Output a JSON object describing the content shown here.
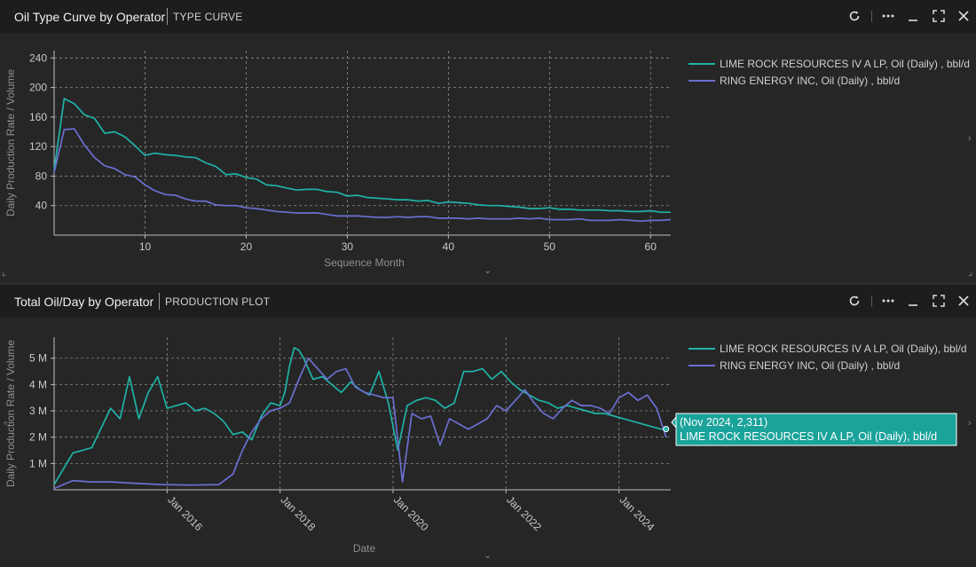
{
  "panels": [
    {
      "title": "Oil Type Curve by Operator",
      "subtitle": "TYPE CURVE",
      "icons": [
        "refresh-icon",
        "more-icon",
        "minimize-icon",
        "fullscreen-icon",
        "close-icon"
      ]
    },
    {
      "title": "Total Oil/Day by Operator",
      "subtitle": "PRODUCTION PLOT",
      "icons": [
        "refresh-icon",
        "more-icon",
        "minimize-icon",
        "fullscreen-icon",
        "close-icon"
      ]
    }
  ],
  "colors": {
    "teal": "#1fb3a6",
    "blue": "#6b6fd1",
    "grid": "#8c8c8c"
  },
  "chart_data": [
    {
      "type": "line",
      "title": "Oil Type Curve by Operator",
      "xlabel": "Sequence Month",
      "ylabel": "Daily Production Rate / Volume",
      "xlim": [
        1,
        62
      ],
      "ylim": [
        0,
        250
      ],
      "x_ticks": [
        10,
        20,
        30,
        40,
        50,
        60
      ],
      "y_ticks": [
        40,
        80,
        120,
        160,
        200,
        240
      ],
      "y_tick_labels": [
        "40",
        "80",
        "120",
        "160",
        "200",
        "240"
      ],
      "grid": true,
      "legend_position": "right",
      "series": [
        {
          "name": "LIME ROCK RESOURCES IV A LP, Oil (Daily) , bbl/d",
          "color": "#1fb3a6",
          "x": [
            1,
            2,
            3,
            4,
            5,
            6,
            7,
            8,
            9,
            10,
            11,
            12,
            13,
            14,
            15,
            16,
            17,
            18,
            19,
            20,
            21,
            22,
            23,
            24,
            25,
            26,
            27,
            28,
            29,
            30,
            31,
            32,
            33,
            34,
            35,
            36,
            37,
            38,
            39,
            40,
            41,
            42,
            43,
            44,
            45,
            46,
            47,
            48,
            49,
            50,
            51,
            52,
            53,
            54,
            55,
            56,
            57,
            58,
            59,
            60,
            61,
            62
          ],
          "y": [
            88,
            185,
            178,
            163,
            158,
            138,
            140,
            133,
            121,
            108,
            111,
            109,
            108,
            106,
            105,
            98,
            93,
            82,
            83,
            78,
            76,
            68,
            67,
            64,
            61,
            62,
            62,
            59,
            58,
            53,
            54,
            51,
            50,
            49,
            48,
            48,
            46,
            47,
            43,
            45,
            44,
            43,
            41,
            40,
            40,
            39,
            38,
            36,
            36,
            37,
            35,
            35,
            34,
            34,
            34,
            33,
            33,
            32,
            32,
            33,
            31,
            31
          ]
        },
        {
          "name": "RING ENERGY INC, Oil (Daily) , bbl/d",
          "color": "#6b6fd1",
          "x": [
            1,
            2,
            3,
            4,
            5,
            6,
            7,
            8,
            9,
            10,
            11,
            12,
            13,
            14,
            15,
            16,
            17,
            18,
            19,
            20,
            21,
            22,
            23,
            24,
            25,
            26,
            27,
            28,
            29,
            30,
            31,
            32,
            33,
            34,
            35,
            36,
            37,
            38,
            39,
            40,
            41,
            42,
            43,
            44,
            45,
            46,
            47,
            48,
            49,
            50,
            51,
            52,
            53,
            54,
            55,
            56,
            57,
            58,
            59,
            60,
            61,
            62
          ],
          "y": [
            85,
            143,
            144,
            122,
            105,
            94,
            90,
            82,
            79,
            68,
            60,
            55,
            54,
            49,
            46,
            46,
            41,
            40,
            40,
            37,
            36,
            34,
            32,
            31,
            30,
            30,
            30,
            28,
            26,
            26,
            26,
            25,
            24,
            24,
            25,
            24,
            25,
            25,
            23,
            23,
            23,
            22,
            23,
            22,
            22,
            22,
            23,
            22,
            23,
            21,
            21,
            21,
            22,
            20,
            20,
            20,
            21,
            20,
            19,
            20,
            20,
            21
          ]
        }
      ]
    },
    {
      "type": "line",
      "title": "Total Oil/Day by Operator",
      "xlabel": "Date",
      "ylabel": "Daily Production Rate / Volume",
      "xlim": [
        "Jan 2014",
        "Dec 2024"
      ],
      "ylim": [
        0,
        5800000
      ],
      "x_ticks": [
        "Jan 2016",
        "Jan 2018",
        "Jan 2020",
        "Jan 2022",
        "Jan 2024"
      ],
      "y_ticks": [
        1000000,
        2000000,
        3000000,
        4000000,
        5000000
      ],
      "y_tick_labels": [
        "1 M",
        "2 M",
        "3 M",
        "4 M",
        "5 M"
      ],
      "grid": true,
      "legend_position": "right",
      "series": [
        {
          "name": "LIME ROCK RESOURCES IV A LP, Oil (Daily), bbl/d",
          "color": "#1fb3a6",
          "x": [
            "2014-01",
            "2014-05",
            "2014-09",
            "2015-01",
            "2015-03",
            "2015-05",
            "2015-07",
            "2015-09",
            "2015-11",
            "2016-01",
            "2016-03",
            "2016-05",
            "2016-07",
            "2016-09",
            "2016-11",
            "2017-01",
            "2017-03",
            "2017-05",
            "2017-07",
            "2017-09",
            "2017-11",
            "2018-01",
            "2018-02",
            "2018-03",
            "2018-04",
            "2018-05",
            "2018-06",
            "2018-08",
            "2018-10",
            "2018-12",
            "2019-02",
            "2019-04",
            "2019-06",
            "2019-08",
            "2019-10",
            "2019-12",
            "2020-02",
            "2020-04",
            "2020-06",
            "2020-08",
            "2020-10",
            "2020-12",
            "2021-02",
            "2021-04",
            "2021-06",
            "2021-08",
            "2021-10",
            "2021-12",
            "2022-02",
            "2022-04",
            "2022-06",
            "2022-08",
            "2022-10",
            "2022-12",
            "2023-02",
            "2023-04",
            "2023-06",
            "2023-08",
            "2023-10",
            "2023-12",
            "2024-02",
            "2024-04",
            "2024-06",
            "2024-08",
            "2024-10",
            "2024-11"
          ],
          "y": [
            200000,
            1400000,
            1600000,
            3100000,
            2700000,
            4300000,
            2700000,
            3700000,
            4300000,
            3100000,
            3200000,
            3300000,
            3000000,
            3100000,
            2900000,
            2600000,
            2100000,
            2200000,
            1900000,
            2800000,
            3300000,
            3200000,
            3700000,
            4700000,
            5400000,
            5300000,
            5000000,
            4200000,
            4300000,
            4000000,
            3700000,
            4100000,
            3800000,
            3600000,
            4500000,
            3300000,
            1500000,
            3200000,
            3400000,
            3500000,
            3400000,
            3100000,
            3300000,
            4500000,
            4500000,
            4600000,
            4200000,
            4500000,
            4100000,
            3800000,
            3600000,
            3400000,
            3300000,
            3100000,
            3200000,
            3100000,
            3000000,
            2900000,
            2900000,
            2800000,
            2700000,
            2600000,
            2500000,
            2400000,
            2300000,
            2311000
          ]
        },
        {
          "name": "RING ENERGY INC, Oil (Daily) , bbl/d",
          "color": "#6b6fd1",
          "x": [
            "2014-01",
            "2014-05",
            "2014-09",
            "2015-01",
            "2015-06",
            "2015-12",
            "2016-06",
            "2016-12",
            "2017-03",
            "2017-05",
            "2017-07",
            "2017-09",
            "2017-11",
            "2018-01",
            "2018-03",
            "2018-05",
            "2018-07",
            "2018-09",
            "2018-11",
            "2019-01",
            "2019-03",
            "2019-05",
            "2019-07",
            "2019-09",
            "2019-11",
            "2020-01",
            "2020-03",
            "2020-05",
            "2020-07",
            "2020-09",
            "2020-11",
            "2021-01",
            "2021-03",
            "2021-05",
            "2021-07",
            "2021-09",
            "2021-11",
            "2022-01",
            "2022-03",
            "2022-05",
            "2022-07",
            "2022-09",
            "2022-11",
            "2023-01",
            "2023-03",
            "2023-05",
            "2023-07",
            "2023-09",
            "2023-11",
            "2024-01",
            "2024-03",
            "2024-05",
            "2024-07",
            "2024-09",
            "2024-11"
          ],
          "y": [
            50000,
            350000,
            300000,
            300000,
            250000,
            200000,
            180000,
            200000,
            600000,
            1500000,
            2200000,
            2700000,
            3000000,
            3100000,
            3300000,
            4200000,
            5000000,
            4600000,
            4200000,
            4500000,
            4600000,
            3900000,
            3700000,
            3600000,
            3500000,
            3500000,
            300000,
            2900000,
            2700000,
            2800000,
            1700000,
            2700000,
            2500000,
            2300000,
            2500000,
            2700000,
            3200000,
            3000000,
            3400000,
            3800000,
            3300000,
            2900000,
            2700000,
            3100000,
            3400000,
            3200000,
            3200000,
            3100000,
            2900000,
            3500000,
            3700000,
            3400000,
            3600000,
            3100000,
            2000000
          ]
        }
      ],
      "tooltip": {
        "line1": "(Nov 2024, 2,311)",
        "line2": "LIME ROCK RESOURCES IV A LP, Oil (Daily), bbl/d"
      }
    }
  ]
}
